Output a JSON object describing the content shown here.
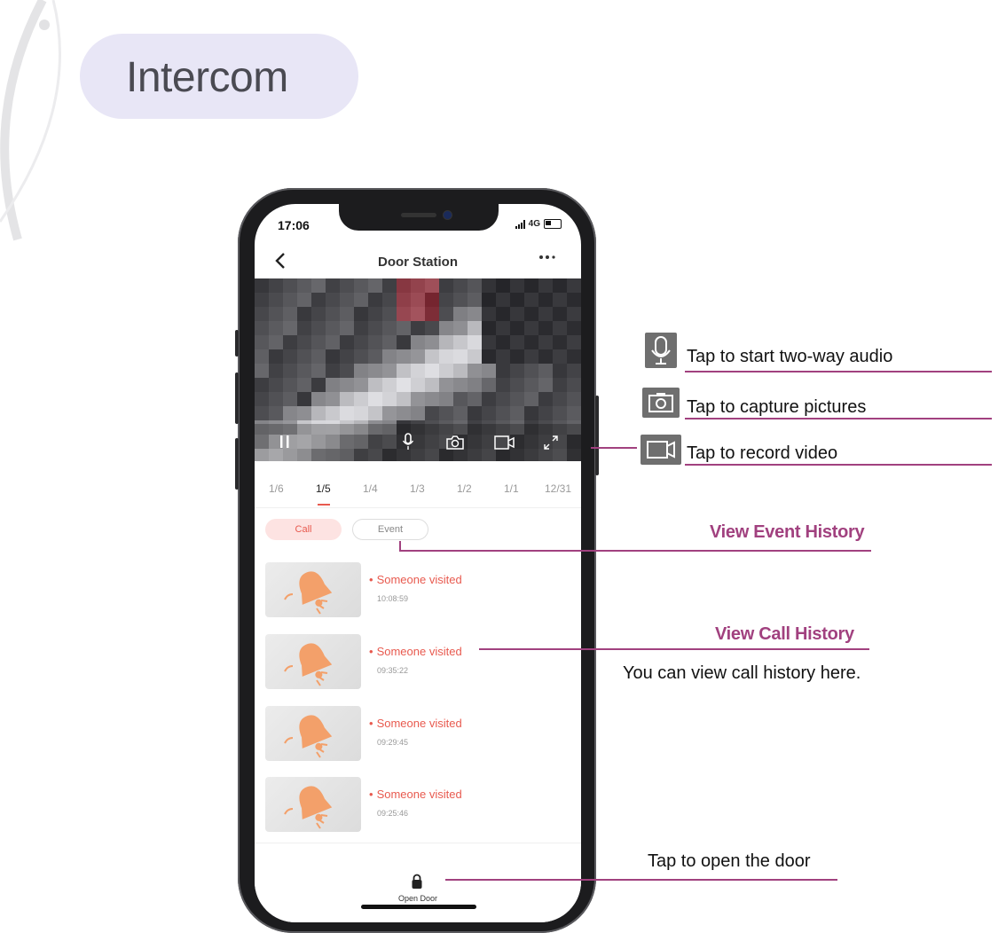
{
  "page": {
    "title": "Intercom"
  },
  "phone": {
    "status_time": "17:06",
    "network": "4G",
    "nav_title": "Door Station",
    "date_tabs": [
      "1/6",
      "1/5",
      "1/4",
      "1/3",
      "1/2",
      "1/1",
      "12/31"
    ],
    "selected_date": "1/5",
    "tabs": {
      "call": "Call",
      "event": "Event",
      "selected": "Call"
    },
    "entries": [
      {
        "title": "Someone visited",
        "time": "10:08:59"
      },
      {
        "title": "Someone visited",
        "time": "09:35:22"
      },
      {
        "title": "Someone visited",
        "time": "09:29:45"
      },
      {
        "title": "Someone visited",
        "time": "09:25:46"
      }
    ],
    "open_door_label": "Open Door",
    "icons": [
      "back-arrow",
      "more-dots",
      "pause",
      "microphone",
      "camera",
      "video-record",
      "fullscreen",
      "bell",
      "lock"
    ]
  },
  "annotations": {
    "audio": "Tap to start two-way audio",
    "capture": "Tap to capture pictures",
    "record": "Tap to record video",
    "event_history": "View Event History",
    "call_history": "View Call History",
    "call_history_desc": "You can view call history here.",
    "open_door": "Tap to open the door"
  },
  "colors": {
    "accent": "#e85a4f",
    "annotation": "#a1417f",
    "title_pill": "#e8e6f6",
    "bell": "#f3a06a"
  }
}
